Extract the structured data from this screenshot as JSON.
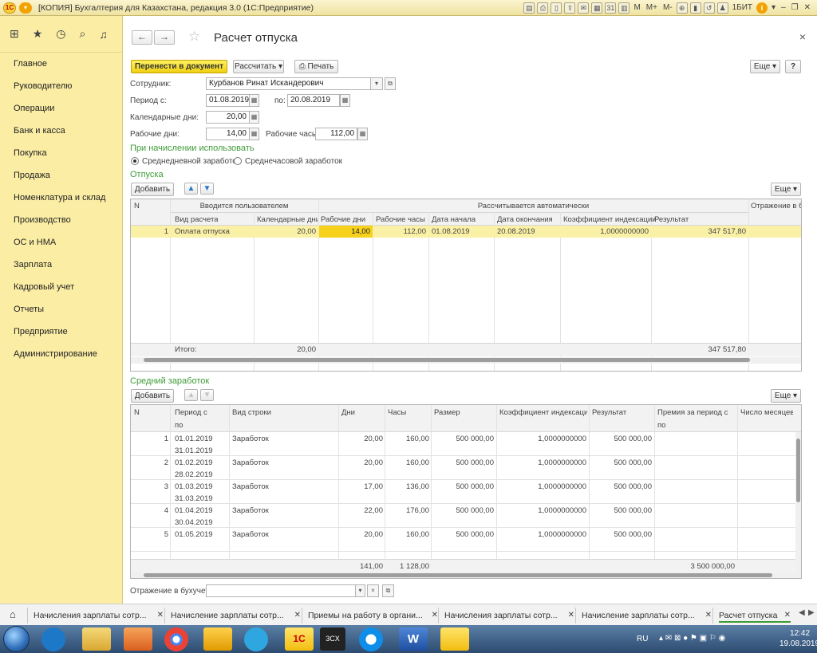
{
  "window": {
    "title": "[КОПИЯ] Бухгалтерия для Казахстана, редакция 3.0  (1С:Предприятие)",
    "user": "1БИТ",
    "memory_buttons": [
      "M",
      "M+",
      "M-"
    ]
  },
  "sections": [
    "Главное",
    "Руководителю",
    "Операции",
    "Банк и касса",
    "Покупка",
    "Продажа",
    "Номенклатура и склад",
    "Производство",
    "ОС и НМА",
    "Зарплата",
    "Кадровый учет",
    "Отчеты",
    "Предприятие",
    "Администрирование"
  ],
  "form": {
    "title": "Расчет отпуска",
    "nav_back": "←",
    "nav_forward": "→",
    "close": "×",
    "toolbar": {
      "post_label": "Перенести в документ",
      "calc_label": "Рассчитать",
      "print_label": "Печать",
      "more_label": "Еще",
      "help_label": "?"
    },
    "employee_label": "Сотрудник:",
    "employee_value": "Курбанов Ринат Искандерович",
    "period_from_label": "Период с:",
    "period_from_value": "01.08.2019",
    "period_to_label": "по:",
    "period_to_value": "20.08.2019",
    "cal_days_label": "Календарные дни:",
    "cal_days_value": "20,00",
    "work_days_label": "Рабочие дни:",
    "work_days_value": "14,00",
    "work_hours_label": "Рабочие часы:",
    "work_hours_value": "112,00",
    "use_group_label": "При начислении использовать",
    "radio_daily": "Среднедневной заработок",
    "radio_hourly": "Среднечасовой заработок",
    "radio_selected": "daily",
    "accounting_label": "Отражение в бухучете:",
    "accounting_value": ""
  },
  "vacations": {
    "title": "Отпуска",
    "add_label": "Добавить",
    "more_label": "Еще",
    "group_user": "Вводится пользователем",
    "group_auto": "Рассчитывается автоматически",
    "group_reflect": "Отражение в бух",
    "columns": {
      "n": "N",
      "type": "Вид расчета",
      "cal_days": "Календарные дни",
      "work_days": "Рабочие дни",
      "work_hours": "Рабочие часы",
      "date_start": "Дата начала",
      "date_end": "Дата окончания",
      "coef": "Коэффициент индексации",
      "result": "Результат"
    },
    "rows": [
      {
        "n": "1",
        "type": "Оплата отпуска",
        "cal_days": "20,00",
        "work_days": "14,00",
        "work_hours": "112,00",
        "date_start": "01.08.2019",
        "date_end": "20.08.2019",
        "coef": "1,0000000000",
        "result": "347 517,80"
      }
    ],
    "footer": {
      "label": "Итого:",
      "cal_days": "20,00",
      "result": "347 517,80"
    }
  },
  "avg_earnings": {
    "title": "Средний заработок",
    "add_label": "Добавить",
    "more_label": "Еще",
    "columns": {
      "n": "N",
      "period_from": "Период с",
      "period_to": "по",
      "row_type": "Вид строки",
      "days": "Дни",
      "hours": "Часы",
      "amount": "Размер",
      "coef": "Коэффициент индексации",
      "result": "Результат",
      "bonus": "Премия за период с",
      "bonus_to": "по",
      "months": "Число месяцев"
    },
    "rows": [
      {
        "n": "1",
        "from": "01.01.2019",
        "to": "31.01.2019",
        "type": "Заработок",
        "days": "20,00",
        "hours": "160,00",
        "amount": "500 000,00",
        "coef": "1,0000000000",
        "result": "500 000,00"
      },
      {
        "n": "2",
        "from": "01.02.2019",
        "to": "28.02.2019",
        "type": "Заработок",
        "days": "20,00",
        "hours": "160,00",
        "amount": "500 000,00",
        "coef": "1,0000000000",
        "result": "500 000,00"
      },
      {
        "n": "3",
        "from": "01.03.2019",
        "to": "31.03.2019",
        "type": "Заработок",
        "days": "17,00",
        "hours": "136,00",
        "amount": "500 000,00",
        "coef": "1,0000000000",
        "result": "500 000,00"
      },
      {
        "n": "4",
        "from": "01.04.2019",
        "to": "30.04.2019",
        "type": "Заработок",
        "days": "22,00",
        "hours": "176,00",
        "amount": "500 000,00",
        "coef": "1,0000000000",
        "result": "500 000,00"
      },
      {
        "n": "5",
        "from": "01.05.2019",
        "to": "",
        "type": "Заработок",
        "days": "20,00",
        "hours": "160,00",
        "amount": "500 000,00",
        "coef": "1,0000000000",
        "result": "500 000,00"
      }
    ],
    "footer": {
      "days": "141,00",
      "hours": "1 128,00",
      "result": "3 500 000,00"
    }
  },
  "open_windows": [
    "Начисления зарплаты сотр...",
    "Начисление зарплаты сотр...",
    "Приемы на работу в органи...",
    "Начисления зарплаты сотр...",
    "Начисление зарплаты сотр...",
    "Расчет отпуска"
  ],
  "taskbar": {
    "lang": "RU",
    "time": "12:42",
    "date": "19.08.2019",
    "app_3cx": "3CX",
    "app_1c": "1С"
  },
  "colors": {
    "accent_yellow": "#f7d21c",
    "section_bg": "#fbeda4",
    "green_title": "#3d9b35"
  }
}
